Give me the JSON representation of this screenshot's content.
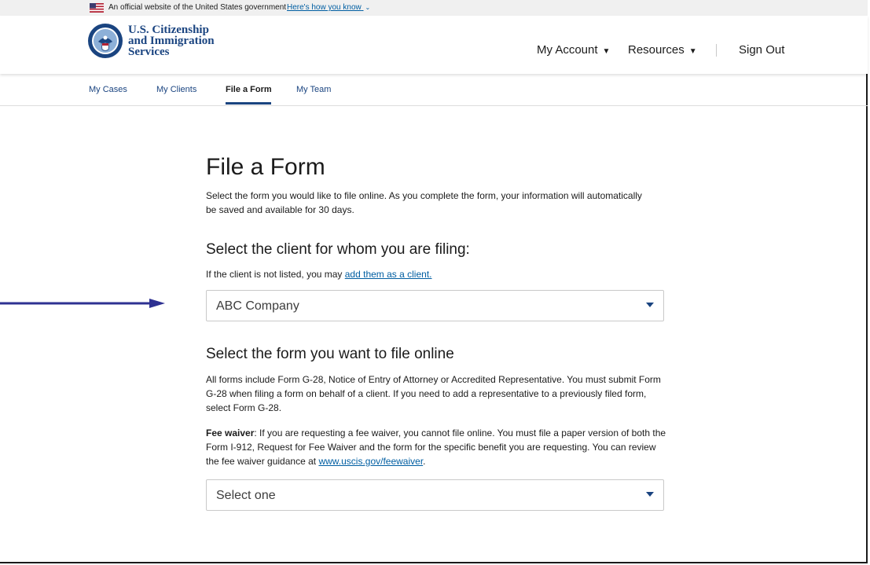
{
  "banner": {
    "official_text": "An official website of the United States government",
    "how_link": "Here's how you know",
    "flag_icon": "us-flag-icon",
    "chevron_icon": "chevron-down-icon"
  },
  "header": {
    "agency_line1": "U.S. Citizenship",
    "agency_line2": "and Immigration",
    "agency_line3": "Services",
    "logo_icon": "dhs-seal-icon",
    "nav": {
      "account": "My Account",
      "resources": "Resources",
      "signout": "Sign Out"
    }
  },
  "tabs": [
    {
      "label": "My Cases",
      "active": false
    },
    {
      "label": "My Clients",
      "active": false
    },
    {
      "label": "File a Form",
      "active": true
    },
    {
      "label": "My Team",
      "active": false
    }
  ],
  "main": {
    "title": "File a Form",
    "intro": "Select the form you would like to file online. As you complete the form, your information will automatically be saved and available for 30 days.",
    "client_heading": "Select the client for whom you are filing:",
    "client_note_prefix": "If the client is not listed, you may ",
    "client_note_link": "add them as a client.",
    "client_select_value": "ABC Company",
    "form_heading": "Select the form you want to file online",
    "form_para": "All forms include Form G-28, Notice of Entry of Attorney or Accredited Representative. You must submit Form G-28 when filing a form on behalf of a client. If you need to add a representative to a previously filed form, select Form G-28.",
    "fee_label": "Fee waiver",
    "fee_para": ": If you are requesting a fee waiver, you cannot file online. You must file a paper version of both the Form I-912, Request for Fee Waiver and the form for the specific benefit you are requesting. You can review the fee waiver guidance at ",
    "fee_link": "www.uscis.gov/feewaiver",
    "fee_end": ".",
    "form_select_value": "Select one"
  },
  "colors": {
    "link": "#005ea2",
    "brand_navy": "#1a4480",
    "arrow": "#2e3192"
  }
}
